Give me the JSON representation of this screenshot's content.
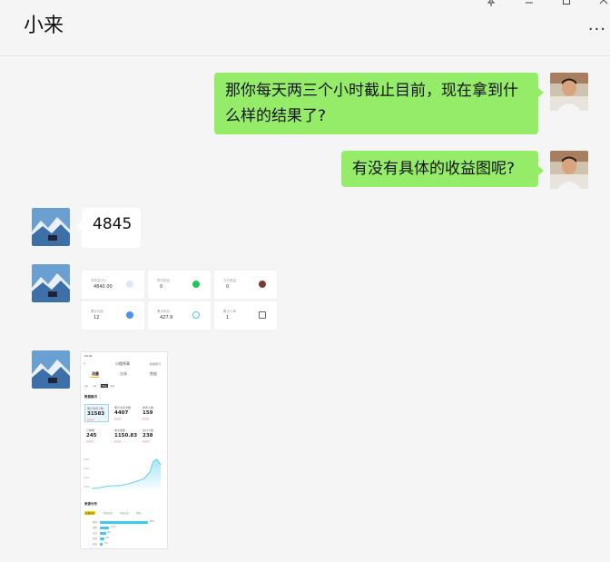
{
  "window": {
    "title": "小来",
    "pin_icon": "pin-icon",
    "minimize_icon": "minimize-icon",
    "maximize_icon": "maximize-icon",
    "close_icon": "close-icon",
    "more_label": "···"
  },
  "messages": [
    {
      "side": "right",
      "text": "那你每天两三个小时截止目前，现在拿到什么样的结果了?"
    },
    {
      "side": "right",
      "text": "有没有具体的收益图呢?"
    },
    {
      "side": "left",
      "text": "4845"
    }
  ],
  "stats_image": {
    "cards": [
      {
        "label": "总收益(元)",
        "value": "4840.00",
        "icon_color": "#5b8ff9"
      },
      {
        "label": "昨日收益",
        "value": "0",
        "icon_color": "#22c55e"
      },
      {
        "label": "今日收益",
        "value": "0",
        "icon_color": "#7a3b2e"
      },
      {
        "label": "累计作品",
        "value": "12",
        "icon_color": "#4f8ef7"
      },
      {
        "label": "累计粉丝",
        "value": "427.9",
        "icon_color": "#5bc0de"
      },
      {
        "label": "累计订单",
        "value": "1",
        "icon_color": "#666666"
      }
    ]
  },
  "phone_image": {
    "status_time": "09:41",
    "page_title": "小程序表",
    "header_right": "数据概况",
    "tabs": [
      "流量",
      "交易",
      "数据"
    ],
    "date_chips": [
      "1天",
      "7天",
      "30天",
      "全部"
    ],
    "section_title": "数据概况",
    "cards": [
      {
        "label": "累计访问人数",
        "value": "31583",
        "sub": "较前日"
      },
      {
        "label": "累计访问次数",
        "value": "4407",
        "sub": "较前日"
      },
      {
        "label": "新增人数",
        "value": "159",
        "sub": "较前日"
      },
      {
        "label": "订单数",
        "value": "245",
        "sub": "较前日"
      },
      {
        "label": "成交金额",
        "value": "1150.83",
        "sub": "较前日"
      },
      {
        "label": "支付人数",
        "value": "238",
        "sub": "较前日"
      }
    ],
    "chart_ylabels": [
      "4000",
      "3000",
      "2000",
      "1000"
    ],
    "distribution_title": "来源分布",
    "dist_tabs": [
      "来源分布",
      "性别分布",
      "年龄分布",
      "地域"
    ],
    "bars": [
      {
        "label": "推荐",
        "pct": 0.92,
        "value": "88%"
      },
      {
        "label": "搜索",
        "pct": 0.18,
        "value": "12%"
      },
      {
        "label": "分享",
        "pct": 0.12,
        "value": "8%"
      },
      {
        "label": "其他",
        "pct": 0.08,
        "value": "4%"
      },
      {
        "label": "直接",
        "pct": 0.06,
        "value": "3%"
      }
    ]
  }
}
